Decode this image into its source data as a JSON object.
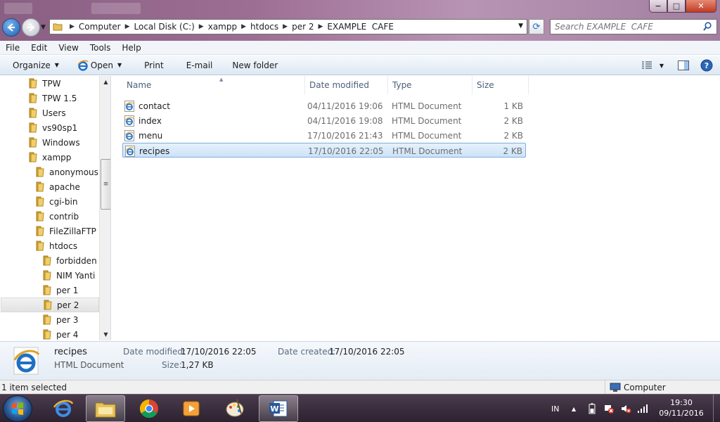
{
  "titlebar": {
    "controls": {
      "minimize": "−",
      "maximize": "□",
      "close": "✕"
    }
  },
  "address": {
    "crumbs": [
      "Computer",
      "Local Disk (C:)",
      "xampp",
      "htdocs",
      "per 2",
      "EXAMPLE  CAFE"
    ]
  },
  "search": {
    "placeholder": "Search EXAMPLE  CAFE"
  },
  "menu": [
    "File",
    "Edit",
    "View",
    "Tools",
    "Help"
  ],
  "toolbar": {
    "organize": "Organize",
    "open": "Open",
    "print": "Print",
    "email": "E-mail",
    "new_folder": "New folder"
  },
  "navpane": {
    "items": [
      {
        "label": "TPW",
        "level": 0
      },
      {
        "label": "TPW 1.5",
        "level": 0
      },
      {
        "label": "Users",
        "level": 0
      },
      {
        "label": "vs90sp1",
        "level": 0
      },
      {
        "label": "Windows",
        "level": 0
      },
      {
        "label": "xampp",
        "level": 0
      },
      {
        "label": "anonymous",
        "level": 1
      },
      {
        "label": "apache",
        "level": 1
      },
      {
        "label": "cgi-bin",
        "level": 1
      },
      {
        "label": "contrib",
        "level": 1
      },
      {
        "label": "FileZillaFTP",
        "level": 1
      },
      {
        "label": "htdocs",
        "level": 1
      },
      {
        "label": "forbidden",
        "level": 2
      },
      {
        "label": "NIM Yanti",
        "level": 2
      },
      {
        "label": "per 1",
        "level": 2
      },
      {
        "label": "per 2",
        "level": 2,
        "selected": true
      },
      {
        "label": "per 3",
        "level": 2
      },
      {
        "label": "per 4",
        "level": 2
      }
    ]
  },
  "filelist": {
    "columns": {
      "name": "Name",
      "date": "Date modified",
      "type": "Type",
      "size": "Size"
    },
    "rows": [
      {
        "name": "contact",
        "date": "04/11/2016 19:06",
        "type": "HTML Document",
        "size": "1 KB"
      },
      {
        "name": "index",
        "date": "04/11/2016 19:08",
        "type": "HTML Document",
        "size": "2 KB"
      },
      {
        "name": "menu",
        "date": "17/10/2016 21:43",
        "type": "HTML Document",
        "size": "2 KB"
      },
      {
        "name": "recipes",
        "date": "17/10/2016 22:05",
        "type": "HTML Document",
        "size": "2 KB",
        "selected": true
      }
    ]
  },
  "details": {
    "name": "recipes",
    "type": "HTML Document",
    "modified_label": "Date modified:",
    "modified_value": "17/10/2016 22:05",
    "created_label": "Date created:",
    "created_value": "17/10/2016 22:05",
    "size_label": "Size:",
    "size_value": "1,27 KB"
  },
  "status": {
    "text": "1 item selected",
    "location": "Computer"
  },
  "taskbar": {
    "language": "IN",
    "time": "19:30",
    "date": "09/11/2016"
  },
  "colors": {
    "selection_fill": "#cce3f9",
    "selection_border": "#84acdd",
    "folder_yellow": "#e9c15a",
    "ie_blue": "#1f6fc5"
  }
}
